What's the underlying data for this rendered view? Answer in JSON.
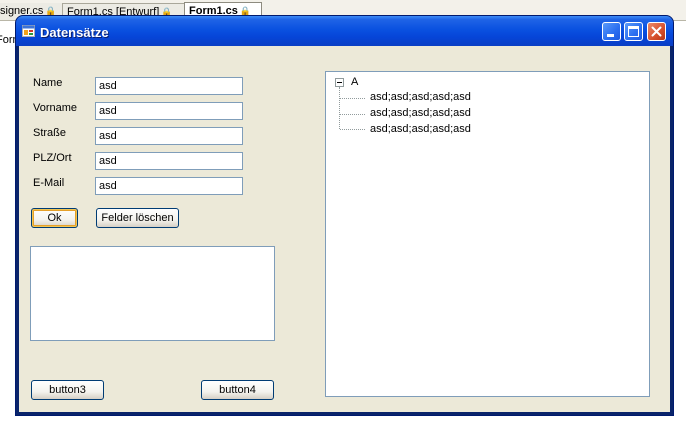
{
  "ide": {
    "tabs": [
      "signer.cs",
      "Form1.cs [Entwurf]",
      "Form1.cs"
    ],
    "second_row_text": "Forr"
  },
  "window": {
    "title": "Datensätze",
    "controls": {
      "minimize": "minimize",
      "maximize": "maximize",
      "close": "close"
    }
  },
  "form": {
    "fields": [
      {
        "label": "Name",
        "value": "asd"
      },
      {
        "label": "Vorname",
        "value": "asd"
      },
      {
        "label": "Straße",
        "value": "asd"
      },
      {
        "label": "PLZ/Ort",
        "value": "asd"
      },
      {
        "label": "E-Mail",
        "value": "asd"
      }
    ],
    "ok_label": "Ok",
    "clear_label": "Felder löschen",
    "button3_label": "button3",
    "button4_label": "button4"
  },
  "tree": {
    "root": "A",
    "children": [
      "asd;asd;asd;asd;asd",
      "asd;asd;asd;asd;asd",
      "asd;asd;asd;asd;asd"
    ]
  },
  "colors": {
    "titlebar": "#0a51e0",
    "client_bg": "#ece9d8",
    "field_border": "#7f9db9",
    "button_border": "#003c74",
    "default_button_focus": "#e5a02a",
    "close_button": "#d6502c"
  }
}
